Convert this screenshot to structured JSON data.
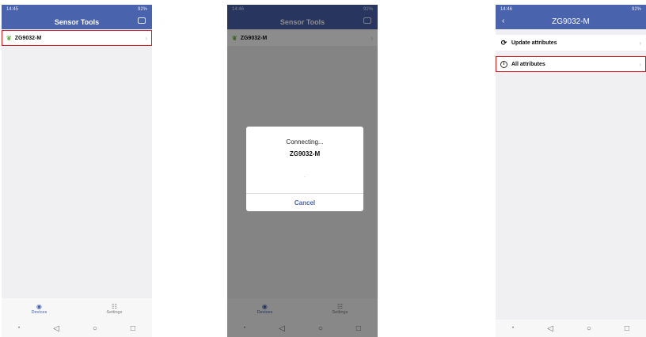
{
  "screen1": {
    "status_time": "14:45",
    "status_right": "92%",
    "title": "Sensor Tools",
    "device_name": "ZG9032-M",
    "nav": {
      "devices": "Devices",
      "settings": "Settings"
    }
  },
  "screen2": {
    "status_time": "14:46",
    "status_right": "92%",
    "title": "Sensor Tools",
    "device_name": "ZG9032-M",
    "dialog": {
      "title": "Connecting...",
      "device": "ZG9032-M",
      "spinner": "·",
      "cancel": "Cancel"
    },
    "nav": {
      "devices": "Devices",
      "settings": "Settings"
    }
  },
  "screen3": {
    "status_time": "14:46",
    "status_right": "92%",
    "title": "ZG9032-M",
    "rows": [
      {
        "label": "Update attributes"
      },
      {
        "label": "All attributes"
      }
    ]
  },
  "colors": {
    "primary": "#4a63ad",
    "highlight": "#d11f26"
  }
}
